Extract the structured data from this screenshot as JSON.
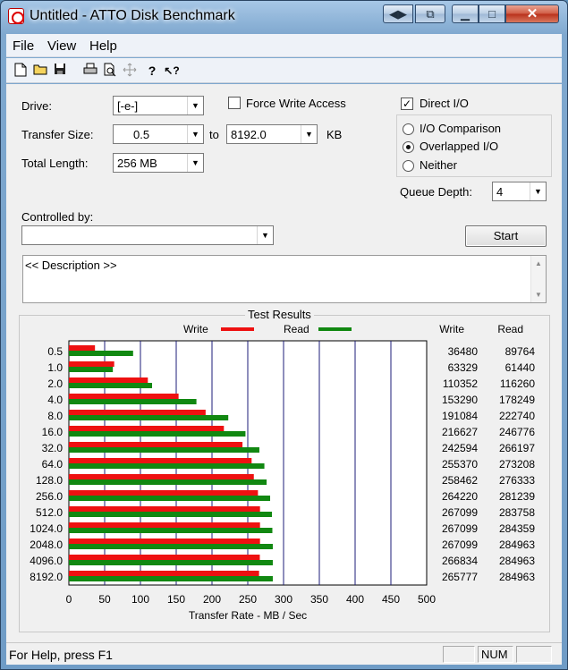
{
  "window": {
    "title": "Untitled - ATTO Disk Benchmark"
  },
  "menu": [
    "File",
    "View",
    "Help"
  ],
  "toolbar_icons": [
    "new-file-icon",
    "open-folder-icon",
    "save-icon",
    "print-icon",
    "print-preview-icon",
    "move-icon",
    "help-icon",
    "context-help-icon"
  ],
  "settings": {
    "drive_label": "Drive:",
    "drive_value": "[-e-]",
    "transfer_size_label": "Transfer Size:",
    "transfer_from": "0.5",
    "to_label": "to",
    "transfer_to": "8192.0",
    "kb_label": "KB",
    "total_length_label": "Total Length:",
    "total_length_value": "256 MB",
    "force_write_label": "Force Write Access",
    "force_write_checked": false,
    "direct_io_label": "Direct I/O",
    "direct_io_checked": true,
    "io_options": [
      {
        "label": "I/O Comparison",
        "selected": false
      },
      {
        "label": "Overlapped I/O",
        "selected": true
      },
      {
        "label": "Neither",
        "selected": false
      }
    ],
    "queue_depth_label": "Queue Depth:",
    "queue_depth_value": "4",
    "controlled_by_label": "Controlled by:",
    "controlled_by_value": "",
    "start_label": "Start",
    "description": "<< Description >>"
  },
  "results_title": "Test Results",
  "chart_data": {
    "type": "bar",
    "orientation": "horizontal",
    "categories": [
      "0.5",
      "1.0",
      "2.0",
      "4.0",
      "8.0",
      "16.0",
      "32.0",
      "64.0",
      "128.0",
      "256.0",
      "512.0",
      "1024.0",
      "2048.0",
      "4096.0",
      "8192.0"
    ],
    "series": [
      {
        "name": "Write",
        "color": "#ee1111",
        "values": [
          36480,
          63329,
          110352,
          153290,
          191084,
          216627,
          242594,
          255370,
          258462,
          264220,
          267099,
          267099,
          267099,
          266834,
          265777
        ]
      },
      {
        "name": "Read",
        "color": "#118811",
        "values": [
          89764,
          61440,
          116260,
          178249,
          222740,
          246776,
          266197,
          273208,
          276333,
          281239,
          283758,
          284359,
          284963,
          284963,
          284963
        ]
      }
    ],
    "column_headers": [
      "Write",
      "Read"
    ],
    "xlabel": "Transfer Rate - MB / Sec",
    "xticks": [
      "0",
      "50",
      "100",
      "150",
      "200",
      "250",
      "300",
      "350",
      "400",
      "450",
      "500"
    ],
    "xlim": [
      0,
      500
    ],
    "legend_position": "top",
    "grid": true
  },
  "status": {
    "help_text": "For Help, press F1",
    "num_label": "NUM"
  }
}
